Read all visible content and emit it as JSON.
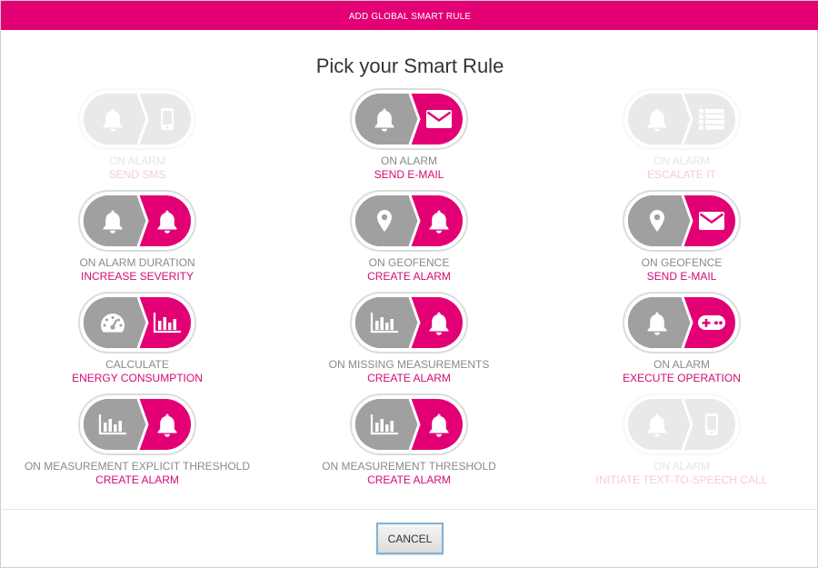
{
  "header": {
    "title": "ADD GLOBAL SMART RULE"
  },
  "title": "Pick your Smart Rule",
  "colors": {
    "accent": "#e20074",
    "grey": "#a0a0a0",
    "label_grey": "#8a8a8a",
    "label_pink": "#d40a74"
  },
  "rules": [
    {
      "line1": "ON ALARM",
      "line2": "SEND SMS",
      "left_icon": "bell-icon",
      "right_icon": "mobile-phone-icon",
      "enabled": false
    },
    {
      "line1": "ON ALARM",
      "line2": "SEND E-MAIL",
      "left_icon": "bell-icon",
      "right_icon": "envelope-icon",
      "enabled": true
    },
    {
      "line1": "ON ALARM",
      "line2": "ESCALATE IT",
      "left_icon": "bell-icon",
      "right_icon": "list-icon",
      "enabled": false
    },
    {
      "line1": "ON ALARM DURATION",
      "line2": "INCREASE SEVERITY",
      "left_icon": "bell-icon",
      "right_icon": "bell-icon",
      "enabled": true
    },
    {
      "line1": "ON GEOFENCE",
      "line2": "CREATE ALARM",
      "left_icon": "map-marker-icon",
      "right_icon": "bell-icon",
      "enabled": true
    },
    {
      "line1": "ON GEOFENCE",
      "line2": "SEND E-MAIL",
      "left_icon": "map-marker-icon",
      "right_icon": "envelope-icon",
      "enabled": true
    },
    {
      "line1": "CALCULATE",
      "line2": "ENERGY CONSUMPTION",
      "left_icon": "gauge-icon",
      "right_icon": "bar-chart-icon",
      "enabled": true
    },
    {
      "line1": "ON MISSING MEASUREMENTS",
      "line2": "CREATE ALARM",
      "left_icon": "bar-chart-icon",
      "right_icon": "bell-icon",
      "enabled": true
    },
    {
      "line1": "ON ALARM",
      "line2": "EXECUTE OPERATION",
      "left_icon": "bell-icon",
      "right_icon": "gamepad-icon",
      "enabled": true
    },
    {
      "line1": "ON MEASUREMENT EXPLICIT THRESHOLD",
      "line2": "CREATE ALARM",
      "left_icon": "bar-chart-icon",
      "right_icon": "bell-icon",
      "enabled": true
    },
    {
      "line1": "ON MEASUREMENT THRESHOLD",
      "line2": "CREATE ALARM",
      "left_icon": "bar-chart-icon",
      "right_icon": "bell-icon",
      "enabled": true
    },
    {
      "line1": "ON ALARM",
      "line2": "INITIATE TEXT-TO-SPEECH CALL",
      "left_icon": "bell-icon",
      "right_icon": "mobile-phone-icon",
      "enabled": false
    }
  ],
  "footer": {
    "cancel_label": "CANCEL"
  }
}
